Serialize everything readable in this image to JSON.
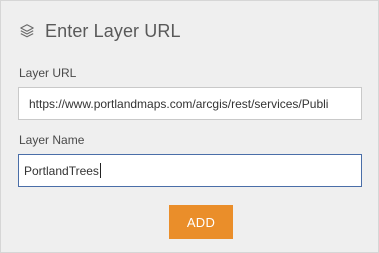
{
  "header": {
    "icon": "layers-icon",
    "title": "Enter Layer URL"
  },
  "form": {
    "url_label": "Layer URL",
    "url_value": "https://www.portlandmaps.com/arcgis/rest/services/Publi",
    "name_label": "Layer Name",
    "name_value": "PortlandTrees",
    "add_label": "ADD"
  },
  "colors": {
    "panel_bg": "#efefef",
    "title_text": "#595959",
    "focus_border": "#4a6ea8",
    "add_button_bg": "#ea8e2a",
    "add_button_text": "#ffffff"
  }
}
